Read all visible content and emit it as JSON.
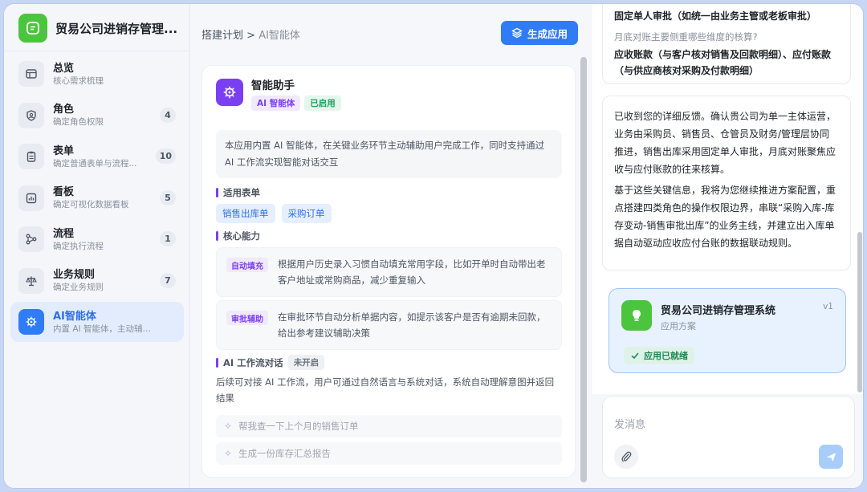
{
  "app": {
    "title": "贸易公司进销存管理...",
    "logo_icon": "note-icon",
    "accent": "#4cc53e"
  },
  "sidebar": {
    "items": [
      {
        "label": "总览",
        "sub": "核心需求梳理",
        "badge": "",
        "icon": "layout-icon"
      },
      {
        "label": "角色",
        "sub": "确定角色权限",
        "badge": "4",
        "icon": "shield-user-icon"
      },
      {
        "label": "表单",
        "sub": "确定普通表单与流程...",
        "badge": "10",
        "icon": "clipboard-icon"
      },
      {
        "label": "看板",
        "sub": "确定可视化数据看板",
        "badge": "5",
        "icon": "chart-icon"
      },
      {
        "label": "流程",
        "sub": "确定执行流程",
        "badge": "1",
        "icon": "flow-icon"
      },
      {
        "label": "业务规则",
        "sub": "确定业务规则",
        "badge": "7",
        "icon": "scale-icon"
      },
      {
        "label": "AI智能体",
        "sub": "内置 AI 智能体，主动辅助并...",
        "badge": "",
        "icon": "ai-chip-icon",
        "active": true
      }
    ]
  },
  "header": {
    "crumb_parent": "搭建计划",
    "crumb_sep": ">",
    "crumb_current": "AI智能体",
    "generate_label": "生成应用"
  },
  "agent": {
    "name": "智能助手",
    "tag_type": "AI 智能体",
    "tag_status": "已启用",
    "description": "本应用内置 AI 智能体，在关键业务环节主动辅助用户完成工作，同时支持通过 AI 工作流实现智能对话交互",
    "forms_title": "适用表单",
    "forms": [
      "销售出库单",
      "采购订单"
    ],
    "capabilities_title": "核心能力",
    "capabilities": [
      {
        "tag": "自动填充",
        "text": "根据用户历史录入习惯自动填充常用字段，比如开单时自动带出老客户地址或常购商品，减少重复输入"
      },
      {
        "tag": "审批辅助",
        "text": "在审批环节自动分析单据内容，如提示该客户是否有逾期未回款，给出参考建议辅助决策"
      }
    ],
    "workflow_title": "AI 工作流对话",
    "workflow_status": "未开启",
    "workflow_desc": "后续可对接 AI 工作流，用户可通过自然语言与系统对话，系统自动理解意图并返回结果",
    "suggestions": [
      "帮我查一下上个月的销售订单",
      "生成一份库存汇总报告"
    ]
  },
  "chat": {
    "bubble1": {
      "line1": "固定单人审批（如统一由业务主管或老板审批）",
      "question": "月底对账主要侧重哪些维度的核算?",
      "answer": "应收账款（与客户核对销售及回款明细）、应付账款（与供应商核对采购及付款明细）"
    },
    "bubble2": {
      "p1": "已收到您的详细反馈。确认贵公司为单一主体运营，业务由采购员、销售员、仓管员及财务/管理层协同推进，销售出库采用固定单人审批，月底对账聚焦应收与应付账款的往来核算。",
      "p2": "基于这些关键信息，我将为您继续推进方案配置，重点搭建四类角色的操作权限边界，串联“采购入库-库存变动-销售审批出库”的业务主线，并建立出入库单据自动驱动应收应付台账的数据联动规则。"
    },
    "app_card": {
      "title": "贸易公司进销存管理系统",
      "subtitle": "应用方案",
      "version": "v1",
      "status": "应用已就绪"
    },
    "input_placeholder": "发消息"
  }
}
